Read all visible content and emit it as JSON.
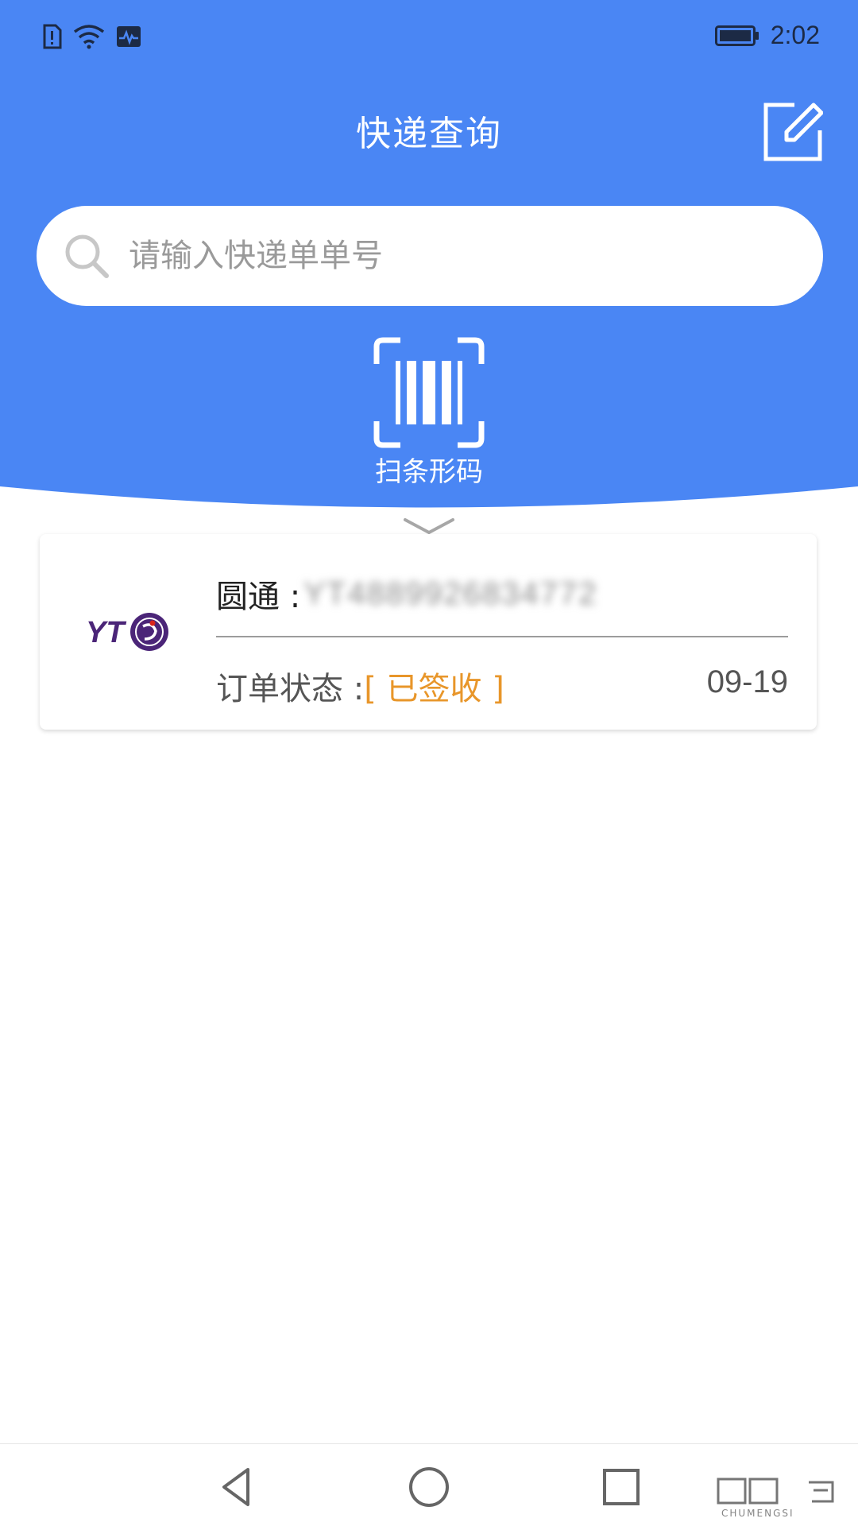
{
  "colors": {
    "primary": "#4A86F4",
    "accent_status": "#E8962A",
    "yto_purple": "#4B2578",
    "yto_red": "#D9251C"
  },
  "status_bar": {
    "time": "2:02",
    "icons": [
      "sim-alert-icon",
      "wifi-icon",
      "activity-icon",
      "battery-icon"
    ]
  },
  "header": {
    "title": "快递查询",
    "edit_icon": "edit-icon"
  },
  "search": {
    "placeholder": "请输入快递单单号",
    "value": "",
    "icon": "search-icon"
  },
  "scan": {
    "label": "扫条形码",
    "icon": "barcode-scan-icon"
  },
  "orders": [
    {
      "logo_text": "YT",
      "carrier": "圆通 : ",
      "tracking_number": "YT4889926834772",
      "status_label": "订单状态 : ",
      "status": "[ 已签收 ]",
      "date": "09-19"
    }
  ],
  "nav": {
    "icons": [
      "back-triangle-icon",
      "home-circle-icon",
      "recents-square-icon"
    ]
  },
  "watermark": {
    "text": "CHUMENGSI"
  }
}
